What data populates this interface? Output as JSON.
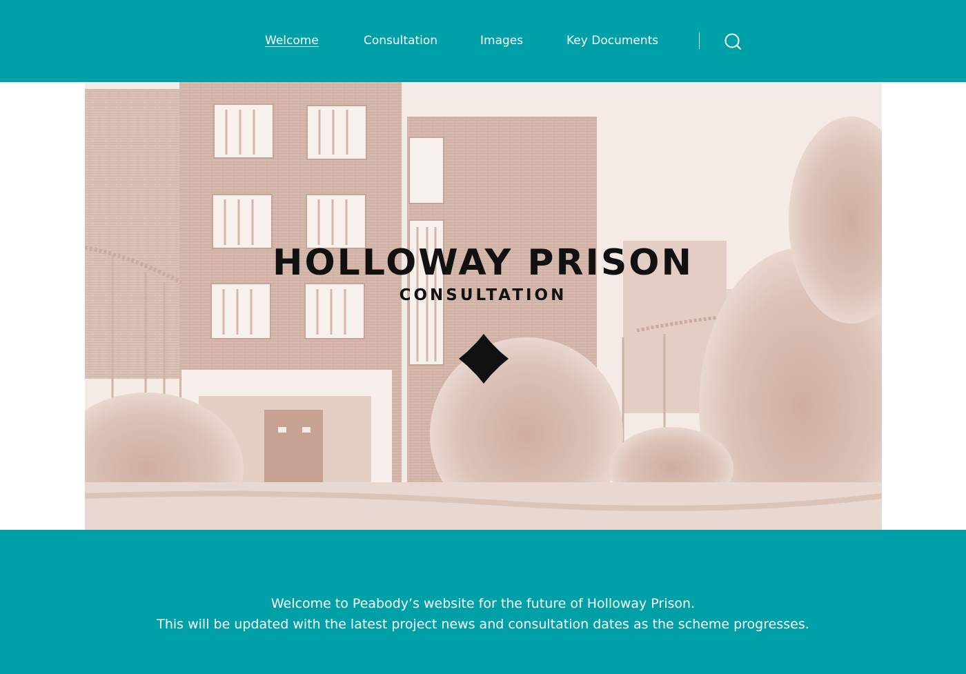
{
  "nav": {
    "items": [
      {
        "label": "Welcome",
        "active": true
      },
      {
        "label": "Consultation",
        "active": false
      },
      {
        "label": "Images",
        "active": false
      },
      {
        "label": "Key Documents",
        "active": false
      }
    ],
    "search_icon": "search-icon"
  },
  "hero": {
    "title": "HOLLOWAY PRISON",
    "subtitle": "CONSULTATION",
    "emblem_icon": "quatrefoil-diamond-icon",
    "photo": "derelict-prison-building-sepia"
  },
  "intro": {
    "line1": "Welcome to Peabody’s website for the future of Holloway Prison.",
    "line2": "This will be updated with the latest project news and consultation dates as the scheme progresses."
  },
  "colors": {
    "brand_teal": "#00a0a8",
    "photo_tint": "#d9bfb4",
    "text_dark": "#111111",
    "text_light": "#ffffff"
  }
}
